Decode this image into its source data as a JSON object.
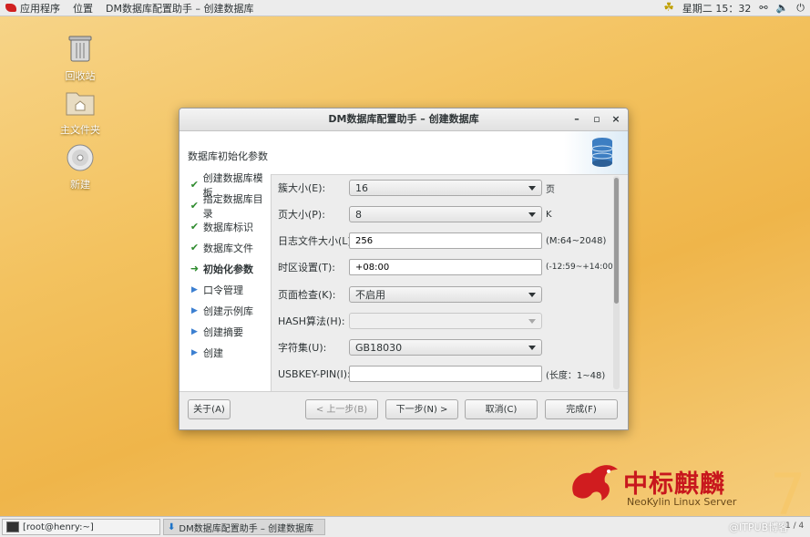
{
  "topbar": {
    "applications": "应用程序",
    "places": "位置",
    "active_window": "DM数据库配置助手 – 创建数据库",
    "clock": "星期二 15：32"
  },
  "desktop": {
    "icons": [
      {
        "label": "回收站",
        "icon": "trash-icon"
      },
      {
        "label": "主文件夹",
        "icon": "home-folder-icon"
      },
      {
        "label": "新建",
        "icon": "disc-icon"
      }
    ]
  },
  "window": {
    "title": "DM数据库配置助手 – 创建数据库",
    "controls": {
      "minimize": "–",
      "maximize": "▫",
      "close": "×"
    },
    "header_title": "数据库初始化参数",
    "steps": [
      {
        "label": "创建数据库模板",
        "state": "done",
        "icon": "✔"
      },
      {
        "label": "指定数据库目录",
        "state": "done",
        "icon": "✔"
      },
      {
        "label": "数据库标识",
        "state": "done",
        "icon": "✔"
      },
      {
        "label": "数据库文件",
        "state": "done",
        "icon": "✔"
      },
      {
        "label": "初始化参数",
        "state": "current",
        "icon": "➜"
      },
      {
        "label": "口令管理",
        "state": "todo",
        "icon": "▶"
      },
      {
        "label": "创建示例库",
        "state": "todo",
        "icon": "▶"
      },
      {
        "label": "创建摘要",
        "state": "todo",
        "icon": "▶"
      },
      {
        "label": "创建",
        "state": "todo",
        "icon": "▶"
      }
    ],
    "form": {
      "extent_size": {
        "label": "簇大小(E):",
        "value": "16",
        "suffix": "页"
      },
      "page_size": {
        "label": "页大小(P):",
        "value": "8",
        "suffix": "K"
      },
      "log_file_size": {
        "label": "日志文件大小(L):",
        "value": "256",
        "suffix": "(M:64~2048)"
      },
      "time_zone": {
        "label": "时区设置(T):",
        "value": "+08:00",
        "suffix": "(-12:59~+14:00)"
      },
      "page_check": {
        "label": "页面检查(K):",
        "value": "不启用"
      },
      "hash_algo": {
        "label": "HASH算法(H):",
        "value": ""
      },
      "charset": {
        "label": "字符集(U):",
        "value": "GB18030"
      },
      "usbkey_pin": {
        "label": "USBKEY-PIN(I):",
        "value": "",
        "suffix": "(长度：1~48)"
      }
    },
    "buttons": {
      "about": "关于(A)",
      "prev": "< 上一步(B)",
      "next": "下一步(N) >",
      "cancel": "取消(C)",
      "finish": "完成(F)"
    }
  },
  "taskbar": {
    "terminal": "[root@henry:~]",
    "dm": "DM数据库配置助手 – 创建数据库",
    "pager": "1 / 4"
  },
  "branding": {
    "cn": "中标麒麟",
    "en": "NeoKylin Linux Server",
    "version": "7"
  },
  "watermark": "@ITPUB博客"
}
